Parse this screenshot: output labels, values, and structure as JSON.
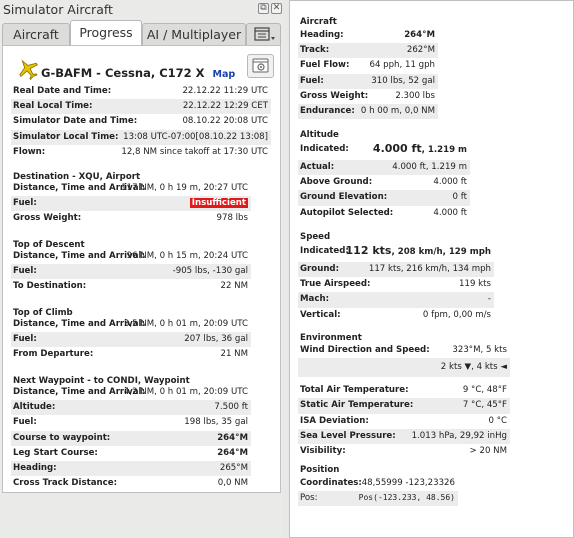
{
  "window": {
    "title": "Simulator Aircraft",
    "btn_float": "⧉",
    "btn_close": "✕"
  },
  "tabs": [
    {
      "label": "Aircraft"
    },
    {
      "label": "Progress"
    },
    {
      "label": "AI / Multiplayer"
    }
  ],
  "aircraft": {
    "title": "G-BAFM - Cessna, C172 X",
    "map": "Map"
  },
  "progress_rows": [
    {
      "k": "Real Date and Time:",
      "v": "22.12.22 11:29 UTC"
    },
    {
      "k": "Real Local Time:",
      "v": "22.12.22 12:29 CET"
    },
    {
      "k": "Simulator Date and Time:",
      "v": "08.10.22 20:08 UTC"
    },
    {
      "k": "Simulator Local Time:",
      "v": "13:08 UTC-07:00[08.10.22 13:08]"
    },
    {
      "k": "Flown:",
      "v": "12,8 NM since takoff at 17:30 UTC"
    }
  ],
  "destination": {
    "title": "Destination - XQU, Airport",
    "rows": [
      {
        "k": "Distance, Time and Arrival:",
        "v": "117 NM, 0 h 19 m, 20:27 UTC"
      },
      {
        "k": "Fuel:",
        "v": "Insufficient"
      },
      {
        "k": "Gross Weight:",
        "v": "978 lbs"
      }
    ]
  },
  "tod": {
    "title": "Top of Descent",
    "rows": [
      {
        "k": "Distance, Time and Arrival:",
        "v": "96 NM, 0 h 15 m, 20:24 UTC"
      },
      {
        "k": "Fuel:",
        "v": "-905 lbs, -130 gal"
      },
      {
        "k": "To Destination:",
        "v": "22 NM"
      }
    ]
  },
  "toc": {
    "title": "Top of Climb",
    "rows": [
      {
        "k": "Distance, Time and Arrival:",
        "v": "3,5 NM, 0 h 01 m, 20:09 UTC"
      },
      {
        "k": "Fuel:",
        "v": "207 lbs, 36 gal"
      },
      {
        "k": "From Departure:",
        "v": "21 NM"
      }
    ]
  },
  "next_wp": {
    "title": "Next Waypoint - to CONDI, Waypoint",
    "rows": [
      {
        "k": "Distance, Time and Arrival:",
        "v": "4,2 NM, 0 h 01 m, 20:09 UTC"
      },
      {
        "k": "Altitude:",
        "v": "7.500 ft"
      },
      {
        "k": "Fuel:",
        "v": "198 lbs, 35 gal"
      },
      {
        "k": "Course to waypoint:",
        "v": "264°M"
      },
      {
        "k": "Leg Start Course:",
        "v": "264°M"
      },
      {
        "k": "Heading:",
        "v": "265°M"
      },
      {
        "k": "Cross Track Distance:",
        "v": "0,0 NM"
      }
    ]
  },
  "right": {
    "aircraft": {
      "title": "Aircraft",
      "rows": [
        {
          "k": "Heading:",
          "v": "264°M"
        },
        {
          "k": "Track:",
          "v": "262°M"
        },
        {
          "k": "Fuel Flow:",
          "v": "64 pph, 11 gph"
        },
        {
          "k": "Fuel:",
          "v": "310 lbs, 52 gal"
        },
        {
          "k": "Gross Weight:",
          "v": "2.300 lbs"
        },
        {
          "k": "Endurance:",
          "v": "0 h 00 m, 0,0 NM"
        }
      ]
    },
    "altitude": {
      "title": "Altitude",
      "indicated_k": "Indicated:",
      "indicated_big": "4.000 ft",
      "indicated_small": "1.219 m",
      "rows": [
        {
          "k": "Actual:",
          "v": "4.000 ft, 1.219 m"
        },
        {
          "k": "Above Ground:",
          "v": "4.000 ft"
        },
        {
          "k": "Ground Elevation:",
          "v": "0 ft"
        },
        {
          "k": "Autopilot Selected:",
          "v": "4.000 ft"
        }
      ]
    },
    "speed": {
      "title": "Speed",
      "indicated_k": "Indicated:",
      "indicated_big": "112 kts",
      "indicated_small": "208 km/h, 129 mph",
      "rows": [
        {
          "k": "Ground:",
          "v": "117 kts, 216 km/h, 134 mph"
        },
        {
          "k": "True Airspeed:",
          "v": "119 kts"
        },
        {
          "k": "Mach:",
          "v": "-"
        },
        {
          "k": "Vertical:",
          "v": "0 fpm, 0,00 m/s"
        }
      ]
    },
    "environment": {
      "title": "Environment",
      "rows": [
        {
          "k": "Wind Direction and Speed:",
          "v": "323°M, 5 kts"
        },
        {
          "k": "",
          "v": "2 kts ▼, 4 kts ◄"
        },
        {
          "k": "Total Air Temperature:",
          "v": "9 °C, 48°F"
        },
        {
          "k": "Static Air Temperature:",
          "v": "7 °C, 45°F"
        },
        {
          "k": "ISA Deviation:",
          "v": "0 °C"
        },
        {
          "k": "Sea Level Pressure:",
          "v": "1.013 hPa, 29,92 inHg"
        },
        {
          "k": "Visibility:",
          "v": "> 20 NM"
        }
      ]
    },
    "position": {
      "title": "Position",
      "rows": [
        {
          "k": "Coordinates:",
          "v": "48,55999 -123,23326"
        },
        {
          "k": "Pos:",
          "v": "Pos(-123.233, 48.56)"
        }
      ]
    }
  },
  "colors": {
    "warning": "#e0191a",
    "link": "#1a3fb0",
    "plane": "#e8c400"
  }
}
